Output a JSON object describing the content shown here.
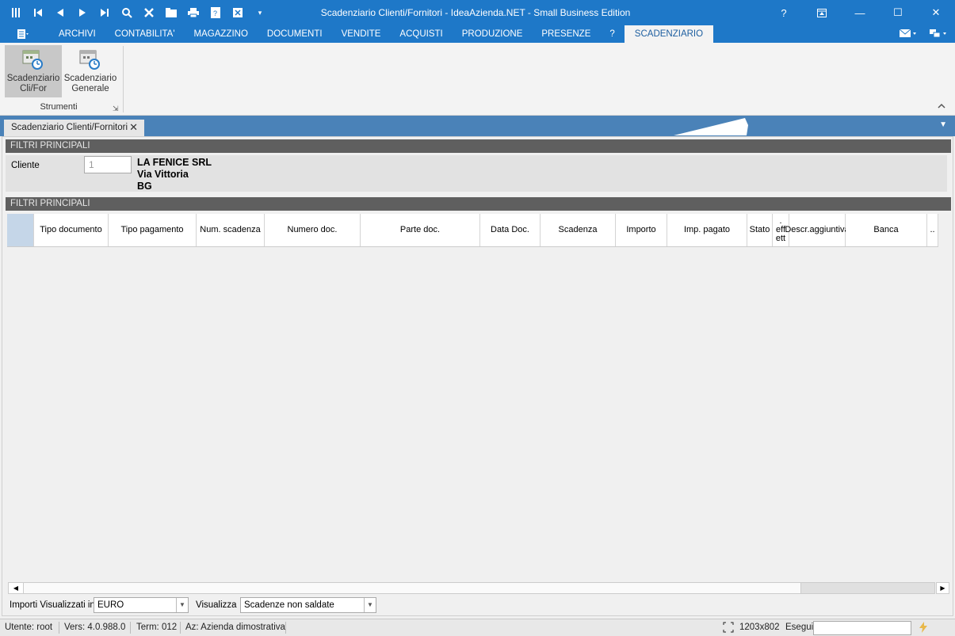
{
  "window": {
    "title": "Scadenziario Clienti/Fornitori - IdeaAzienda.NET - Small Business Edition",
    "controls": {
      "help": "?",
      "minimize": "—",
      "restore": "☐",
      "close": "✕"
    }
  },
  "menu": {
    "items": [
      {
        "label": "ARCHIVI"
      },
      {
        "label": "CONTABILITA'"
      },
      {
        "label": "MAGAZZINO"
      },
      {
        "label": "DOCUMENTI"
      },
      {
        "label": "VENDITE"
      },
      {
        "label": "ACQUISTI"
      },
      {
        "label": "PRODUZIONE"
      },
      {
        "label": "PRESENZE"
      },
      {
        "label": "?"
      },
      {
        "label": "SCADENZIARIO"
      }
    ],
    "active": "SCADENZIARIO"
  },
  "ribbon": {
    "buttons": [
      {
        "label_line1": "Scadenziario",
        "label_line2": "Cli/For"
      },
      {
        "label_line1": "Scadenziario",
        "label_line2": "Generale"
      }
    ],
    "group_label": "Strumenti"
  },
  "doc_tab": {
    "label": "Scadenziario Clienti/Fornitori"
  },
  "filters": {
    "header": "FILTRI PRINCIPALI",
    "cliente_label": "Cliente",
    "cliente_value": "1",
    "cliente_name": "LA FENICE SRL",
    "cliente_address": "Via Vittoria",
    "cliente_city": "BG"
  },
  "grid": {
    "header": "FILTRI PRINCIPALI",
    "columns": [
      "Tipo documento",
      "Tipo pagamento",
      "Num. scadenza",
      "Numero doc.",
      "Parte doc.",
      "Data Doc.",
      "Scadenza",
      "Importo",
      "Imp. pagato",
      "Stato",
      ". eff ett",
      "Descr.aggiuntiva",
      "Banca",
      ".."
    ]
  },
  "bottom": {
    "importi_label": "Importi Visualizzati in",
    "importi_value": "EURO",
    "visualizza_label": "Visualizza",
    "visualizza_value": "Scadenze non saldate"
  },
  "status": {
    "utente": "Utente: root",
    "vers": "Vers: 4.0.988.0",
    "term": "Term: 012",
    "az": "Az: Azienda dimostrativa",
    "resolution": "1203x802",
    "esegui": "Esegui"
  }
}
